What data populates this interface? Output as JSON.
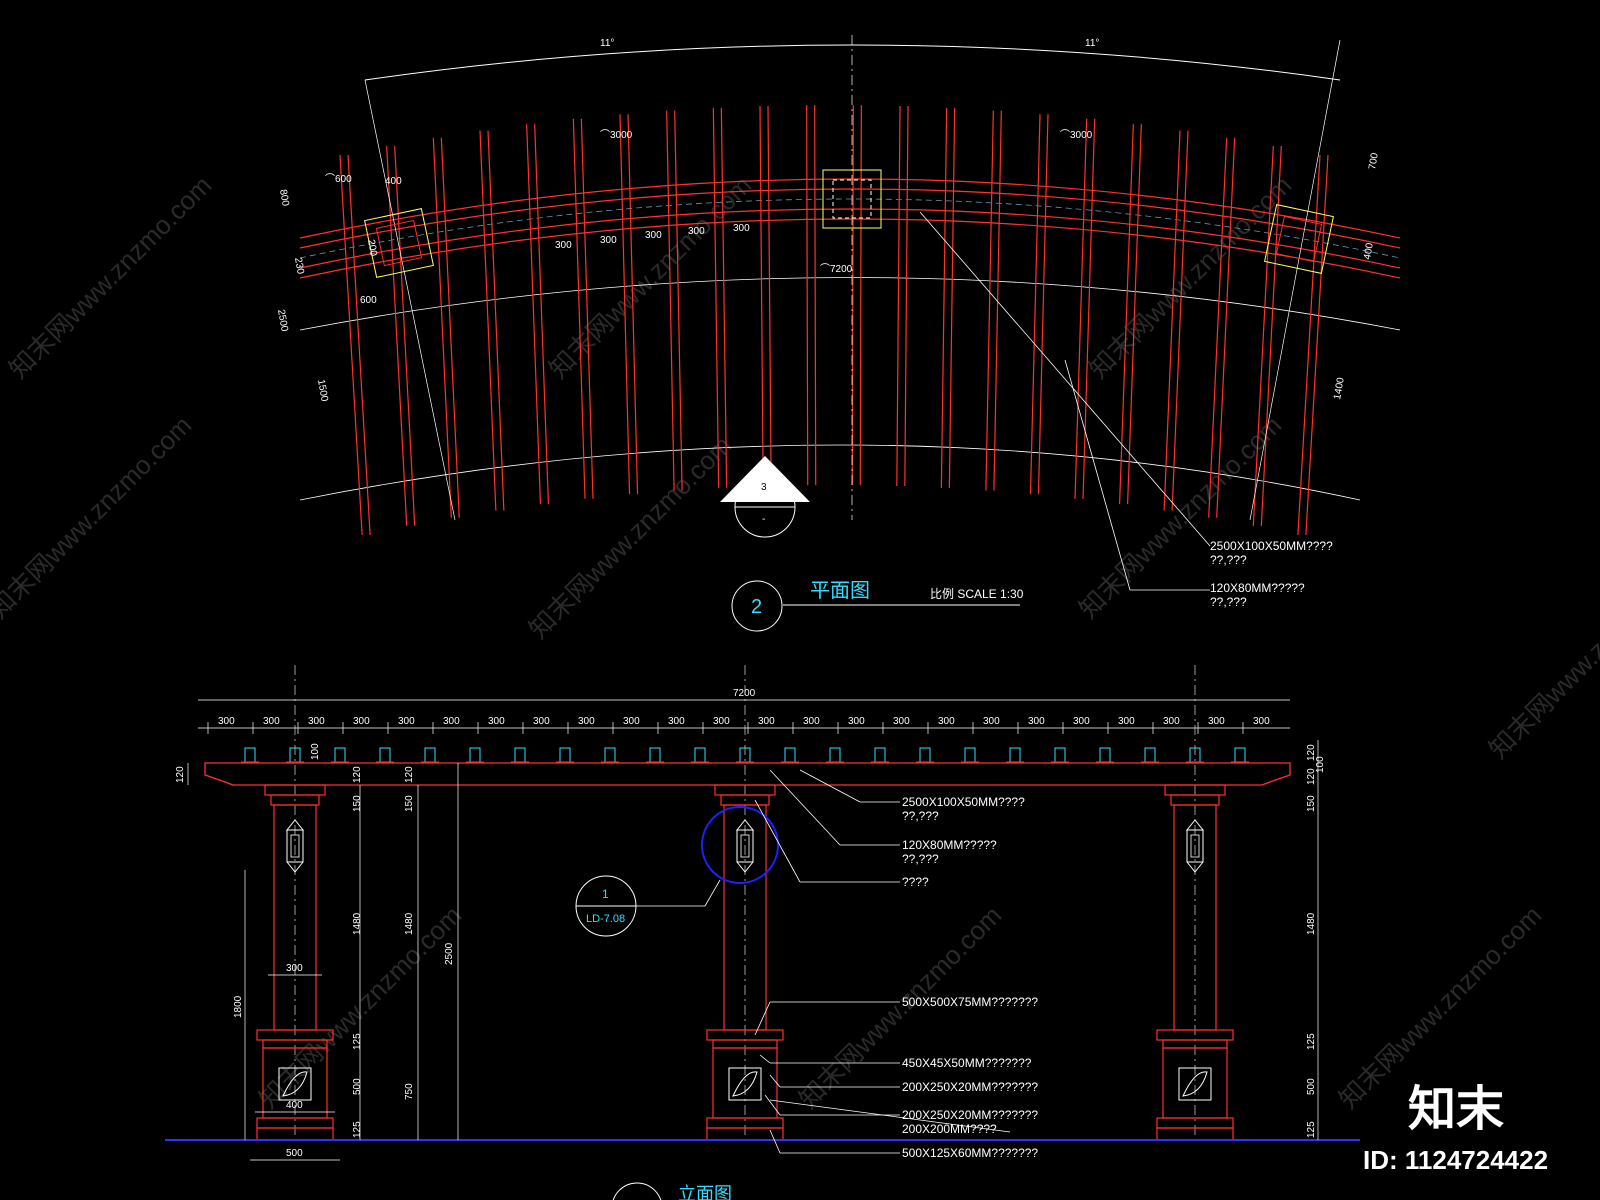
{
  "plan": {
    "angle_left": "11°",
    "angle_right": "11°",
    "radius_left": "⌒3000",
    "radius_right": "⌒3000",
    "radius_center": "⌒7200",
    "radius_small": "⌒600",
    "spacings": [
      "300",
      "300",
      "300",
      "300",
      "300"
    ],
    "left_dims": [
      "800",
      "230",
      "2500",
      "1500"
    ],
    "left_small": [
      "400",
      "200",
      "600"
    ],
    "right_dims": [
      "700",
      "400",
      "1400"
    ],
    "section_marker_number": "3",
    "section_marker_sub": "-",
    "note1_line1": "2500X100X50MM????",
    "note1_line2": "??,???",
    "note2_line1": "120X80MM?????",
    "note2_line2": "??,???",
    "title_number": "2",
    "title": "平面图",
    "scale": "比例 SCALE 1:30"
  },
  "elevation": {
    "overall": "7200",
    "beam_spacing": [
      "300",
      "300",
      "300",
      "300",
      "300",
      "300",
      "300",
      "300",
      "300",
      "300",
      "300",
      "300",
      "300",
      "300",
      "300",
      "300",
      "300",
      "300",
      "300",
      "300",
      "300",
      "300",
      "300",
      "300"
    ],
    "left_dims": [
      "120",
      "1800"
    ],
    "pillar_dims": [
      "120",
      "150",
      "1480",
      "125",
      "500",
      "125"
    ],
    "pillar2_dims": [
      "120",
      "150",
      "1480",
      "750"
    ],
    "total_height": "2500",
    "right_dims": [
      "120",
      "100",
      "120",
      "150",
      "1480",
      "125",
      "500",
      "125"
    ],
    "shaft_width": "300",
    "pedestal_width": "400",
    "base_width": "500",
    "beam_top_dim": "100",
    "callout_number": "1",
    "callout_ref": "LD-7.08",
    "notes": [
      "2500X100X50MM????",
      "??,???",
      "120X80MM?????",
      "??,???",
      "????",
      "500X500X75MM???????",
      "450X45X50MM???????",
      "200X250X20MM???????",
      "200X250X20MM???????",
      "200X200MM????",
      "500X125X60MM???????"
    ],
    "bottom_title": "立面图"
  },
  "watermarks": [
    "知末网www.znzmo.com",
    "知末网www.znzmo.com",
    "知末网www.znzmo.com",
    "知末网www.znzmo.com",
    "知末网www.znzmo.com",
    "知末网www.znzmo.com",
    "知末网www.znzmo.com",
    "知末网www.znzmo.com",
    "知末网www.znzmo.com",
    "知末网www.znzmo.com"
  ],
  "brand": "知末",
  "id_label": "ID: 1124724422",
  "colors": {
    "line_red": "#ff3030",
    "dim_white": "#ffffff",
    "accent_cyan": "#33ddff",
    "ground_blue": "#3030ff",
    "frame_yellow": "#ffff66",
    "callout_blue": "#2020ff"
  }
}
